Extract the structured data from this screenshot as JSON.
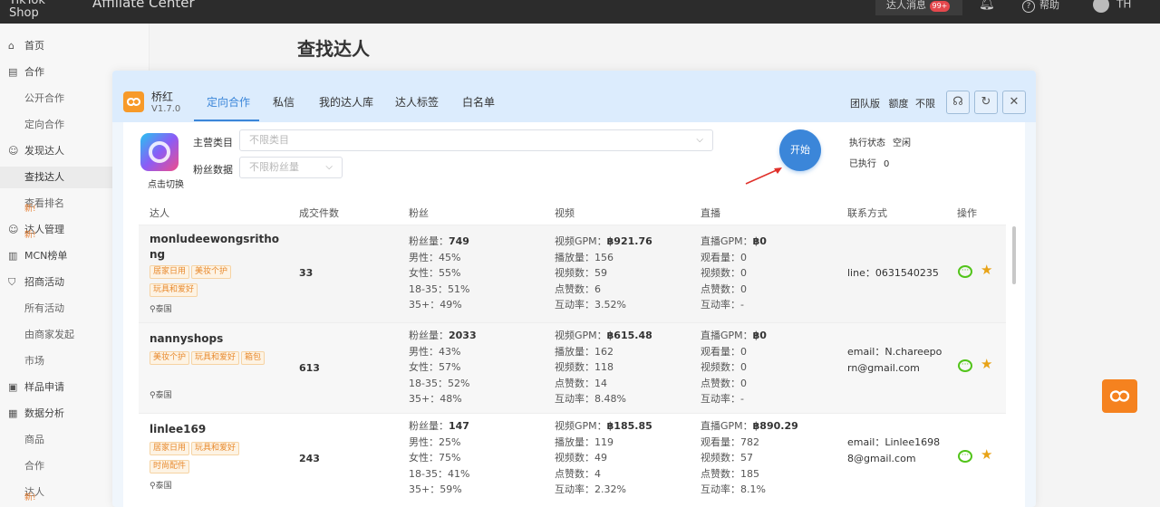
{
  "topbar": {
    "brand_line1": "TikTok",
    "brand_line2": "Shop",
    "title": "Affiliate Center",
    "messages_label": "达人消息",
    "messages_badge": "99+",
    "help_label": "帮助",
    "user_initials": "TH"
  },
  "sidebar": {
    "items": [
      {
        "label": "首页",
        "icon": "home-icon"
      },
      {
        "label": "合作",
        "icon": "clipboard-icon"
      },
      {
        "label": "公开合作"
      },
      {
        "label": "定向合作"
      },
      {
        "label": "发现达人",
        "icon": "user-icon"
      },
      {
        "label": "查找达人"
      },
      {
        "label": "查看排名",
        "badge": "新!"
      },
      {
        "label": "达人管理",
        "icon": "users-icon",
        "badge": "新!"
      },
      {
        "label": "MCN榜单",
        "icon": "ranking-icon"
      },
      {
        "label": "招商活动",
        "icon": "shield-icon"
      },
      {
        "label": "所有活动"
      },
      {
        "label": "由商家发起"
      },
      {
        "label": "市场"
      },
      {
        "label": "样品申请",
        "icon": "gift-icon"
      },
      {
        "label": "数据分析",
        "icon": "chart-icon"
      },
      {
        "label": "商品"
      },
      {
        "label": "合作"
      },
      {
        "label": "达人",
        "badge": "新!"
      }
    ]
  },
  "page": {
    "title": "查找达人"
  },
  "extension": {
    "name": "桥红",
    "version": "V1.7.0",
    "tabs": [
      "定向合作",
      "私信",
      "我的达人库",
      "达人标签",
      "白名单"
    ],
    "edition": "团队版",
    "quota_label": "额度",
    "quota_value": "不限",
    "switch_label": "点击切换",
    "filters": {
      "category_label": "主营类目",
      "category_placeholder": "不限类目",
      "fans_label": "粉丝数据",
      "fans_placeholder": "不限粉丝量"
    },
    "start_label": "开始",
    "exec_status_label": "执行状态",
    "exec_status_value": "空闲",
    "executed_label": "已执行",
    "executed_value": "0",
    "columns": [
      "达人",
      "成交件数",
      "粉丝",
      "视频",
      "直播",
      "联系方式",
      "操作"
    ],
    "rows": [
      {
        "name": "monludeewongsrithong",
        "tags": [
          "居家日用",
          "美妆个护",
          "玩具和爱好"
        ],
        "location": "泰国",
        "deals": "33",
        "fans": [
          "粉丝量：",
          "749",
          "男性：45%",
          "女性：55%",
          "18-35：51%",
          "35+：49%"
        ],
        "video": [
          "视频GPM：",
          "฿921.76",
          "播放量：156",
          "视频数：59",
          "点赞数：6",
          "互动率：3.52%"
        ],
        "live": [
          "直播GPM：",
          "฿0",
          "观看量：0",
          "视频数：0",
          "点赞数：0",
          "互动率：-"
        ],
        "contact": "line：0631540235"
      },
      {
        "name": "nannyshops",
        "tags": [
          "美妆个护",
          "玩具和爱好",
          "箱包"
        ],
        "location": "泰国",
        "deals": "613",
        "fans": [
          "粉丝量：",
          "2033",
          "男性：43%",
          "女性：57%",
          "18-35：52%",
          "35+：48%"
        ],
        "video": [
          "视频GPM：",
          "฿615.48",
          "播放量：162",
          "视频数：118",
          "点赞数：14",
          "互动率：8.48%"
        ],
        "live": [
          "直播GPM：",
          "฿0",
          "观看量：0",
          "视频数：0",
          "点赞数：0",
          "互动率：-"
        ],
        "contact": "email：N.chareeporn@gmail.com"
      },
      {
        "name": "linlee169",
        "tags": [
          "居家日用",
          "玩具和爱好",
          "时尚配件"
        ],
        "location": "泰国",
        "deals": "243",
        "fans": [
          "粉丝量：",
          "147",
          "男性：25%",
          "女性：75%",
          "18-35：41%",
          "35+：59%"
        ],
        "video": [
          "视频GPM：",
          "฿185.85",
          "播放量：119",
          "视频数：49",
          "点赞数：4",
          "互动率：2.32%"
        ],
        "live": [
          "直播GPM：",
          "฿890.29",
          "观看量：782",
          "视频数：57",
          "点赞数：185",
          "互动率：8.1%"
        ],
        "contact": "email：Linlee16988@gmail.com"
      }
    ]
  },
  "colors": {
    "accent": "#3b86d9",
    "brand_orange": "#f5821f",
    "tag_orange": "#e88a2e",
    "chat_green": "#52c41a",
    "star_gold": "#e8a317",
    "arrow_red": "#e0312b"
  }
}
